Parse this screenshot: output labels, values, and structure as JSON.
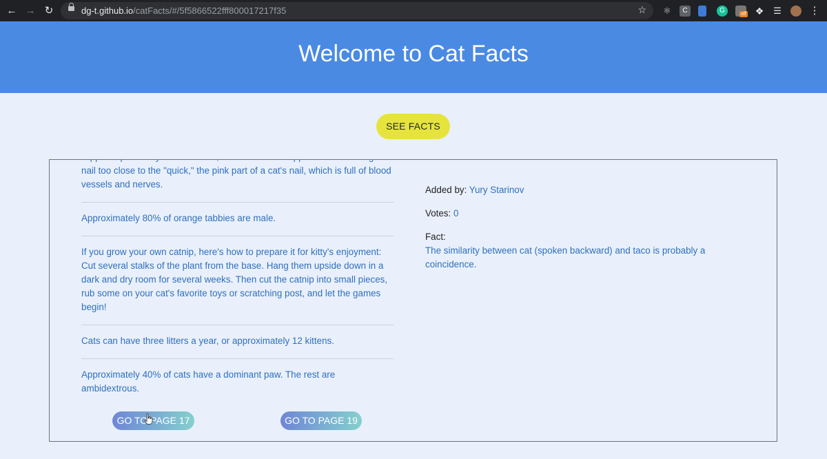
{
  "browser": {
    "url_host": "dg-t.github.io",
    "url_path": "/catFacts/#/5f5866522fff800017217f35",
    "ext_badge": "off"
  },
  "header": {
    "title": "Welcome to Cat Facts"
  },
  "see_facts_label": "SEE FACTS",
  "facts": [
    "clippers specifically for cat's nails, not human nail clippers. Avoid cutting the nail too close to the \"quick,\" the pink part of a cat's nail, which is full of blood vessels and nerves.",
    "Approximately 80% of orange tabbies are male.",
    "If you grow your own catnip, here's how to prepare it for kitty's enjoyment: Cut several stalks of the plant from the base. Hang them upside down in a dark and dry room for several weeks. Then cut the catnip into small pieces, rub some on your cat's favorite toys or scratching post, and let the games begin!",
    "Cats can have three litters a year, or approximately 12 kittens.",
    "Approximately 40% of cats have a dominant paw. The rest are ambidextrous."
  ],
  "detail": {
    "added_by_label": "Added by:",
    "added_by": "Yury Starinov",
    "votes_label": "Votes:",
    "votes": "0",
    "fact_label": "Fact:",
    "fact": "The similarity between cat (spoken backward) and taco is probably a coincidence."
  },
  "pager": {
    "prev_label": "GO TO PAGE 17",
    "next_label": "GO TO PAGE 19"
  },
  "colors": {
    "header_bg": "#4a8ae3",
    "page_bg": "#e9f0fb",
    "see_facts_bg": "#e6e33d",
    "link": "#2f6fbd"
  }
}
